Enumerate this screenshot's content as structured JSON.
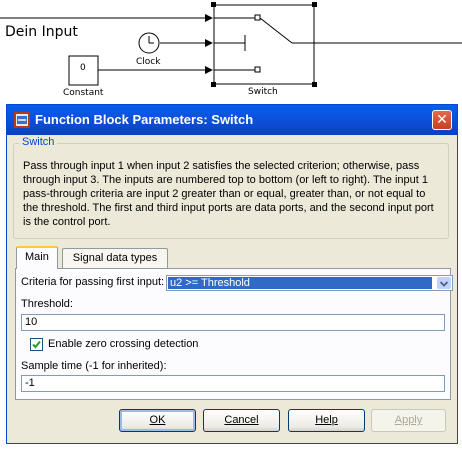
{
  "canvas": {
    "input_label": "Dein Input",
    "clock_label": "Clock",
    "constant_value": "0",
    "constant_label": "Constant",
    "switch_label": "Switch"
  },
  "dialog": {
    "title": "Function Block Parameters: Switch",
    "close_symbol": "✕",
    "group_title": "Switch",
    "description": "Pass through input 1 when input 2 satisfies the selected criterion; otherwise, pass through input 3.  The inputs are numbered top to bottom (or left to right).  The input 1 pass-through criteria are input 2 greater than or equal, greater than, or not equal to the threshold.  The first and third input ports are data ports, and the second input port is the control port.",
    "tabs": [
      {
        "label": "Main",
        "selected": true
      },
      {
        "label": "Signal data types",
        "selected": false
      }
    ],
    "criteria_label": "Criteria for passing first input:",
    "criteria_value": "u2 >= Threshold",
    "threshold_label": "Threshold:",
    "threshold_value": "10",
    "zero_crossing_label": "Enable zero crossing detection",
    "zero_crossing_checked": true,
    "sample_time_label": "Sample time (-1 for inherited):",
    "sample_time_value": "-1",
    "buttons": {
      "ok": "OK",
      "cancel": "Cancel",
      "help": "Help",
      "apply": "Apply"
    },
    "icons": {
      "title": "simulink-block-icon",
      "close": "close-icon",
      "dropdown": "chevron-down-icon",
      "check": "checkmark-icon"
    },
    "colors": {
      "titlebar": "#0c4dd6",
      "dialog_bg": "#ece9d8",
      "selection": "#316ac5",
      "close": "#d2502e"
    }
  }
}
